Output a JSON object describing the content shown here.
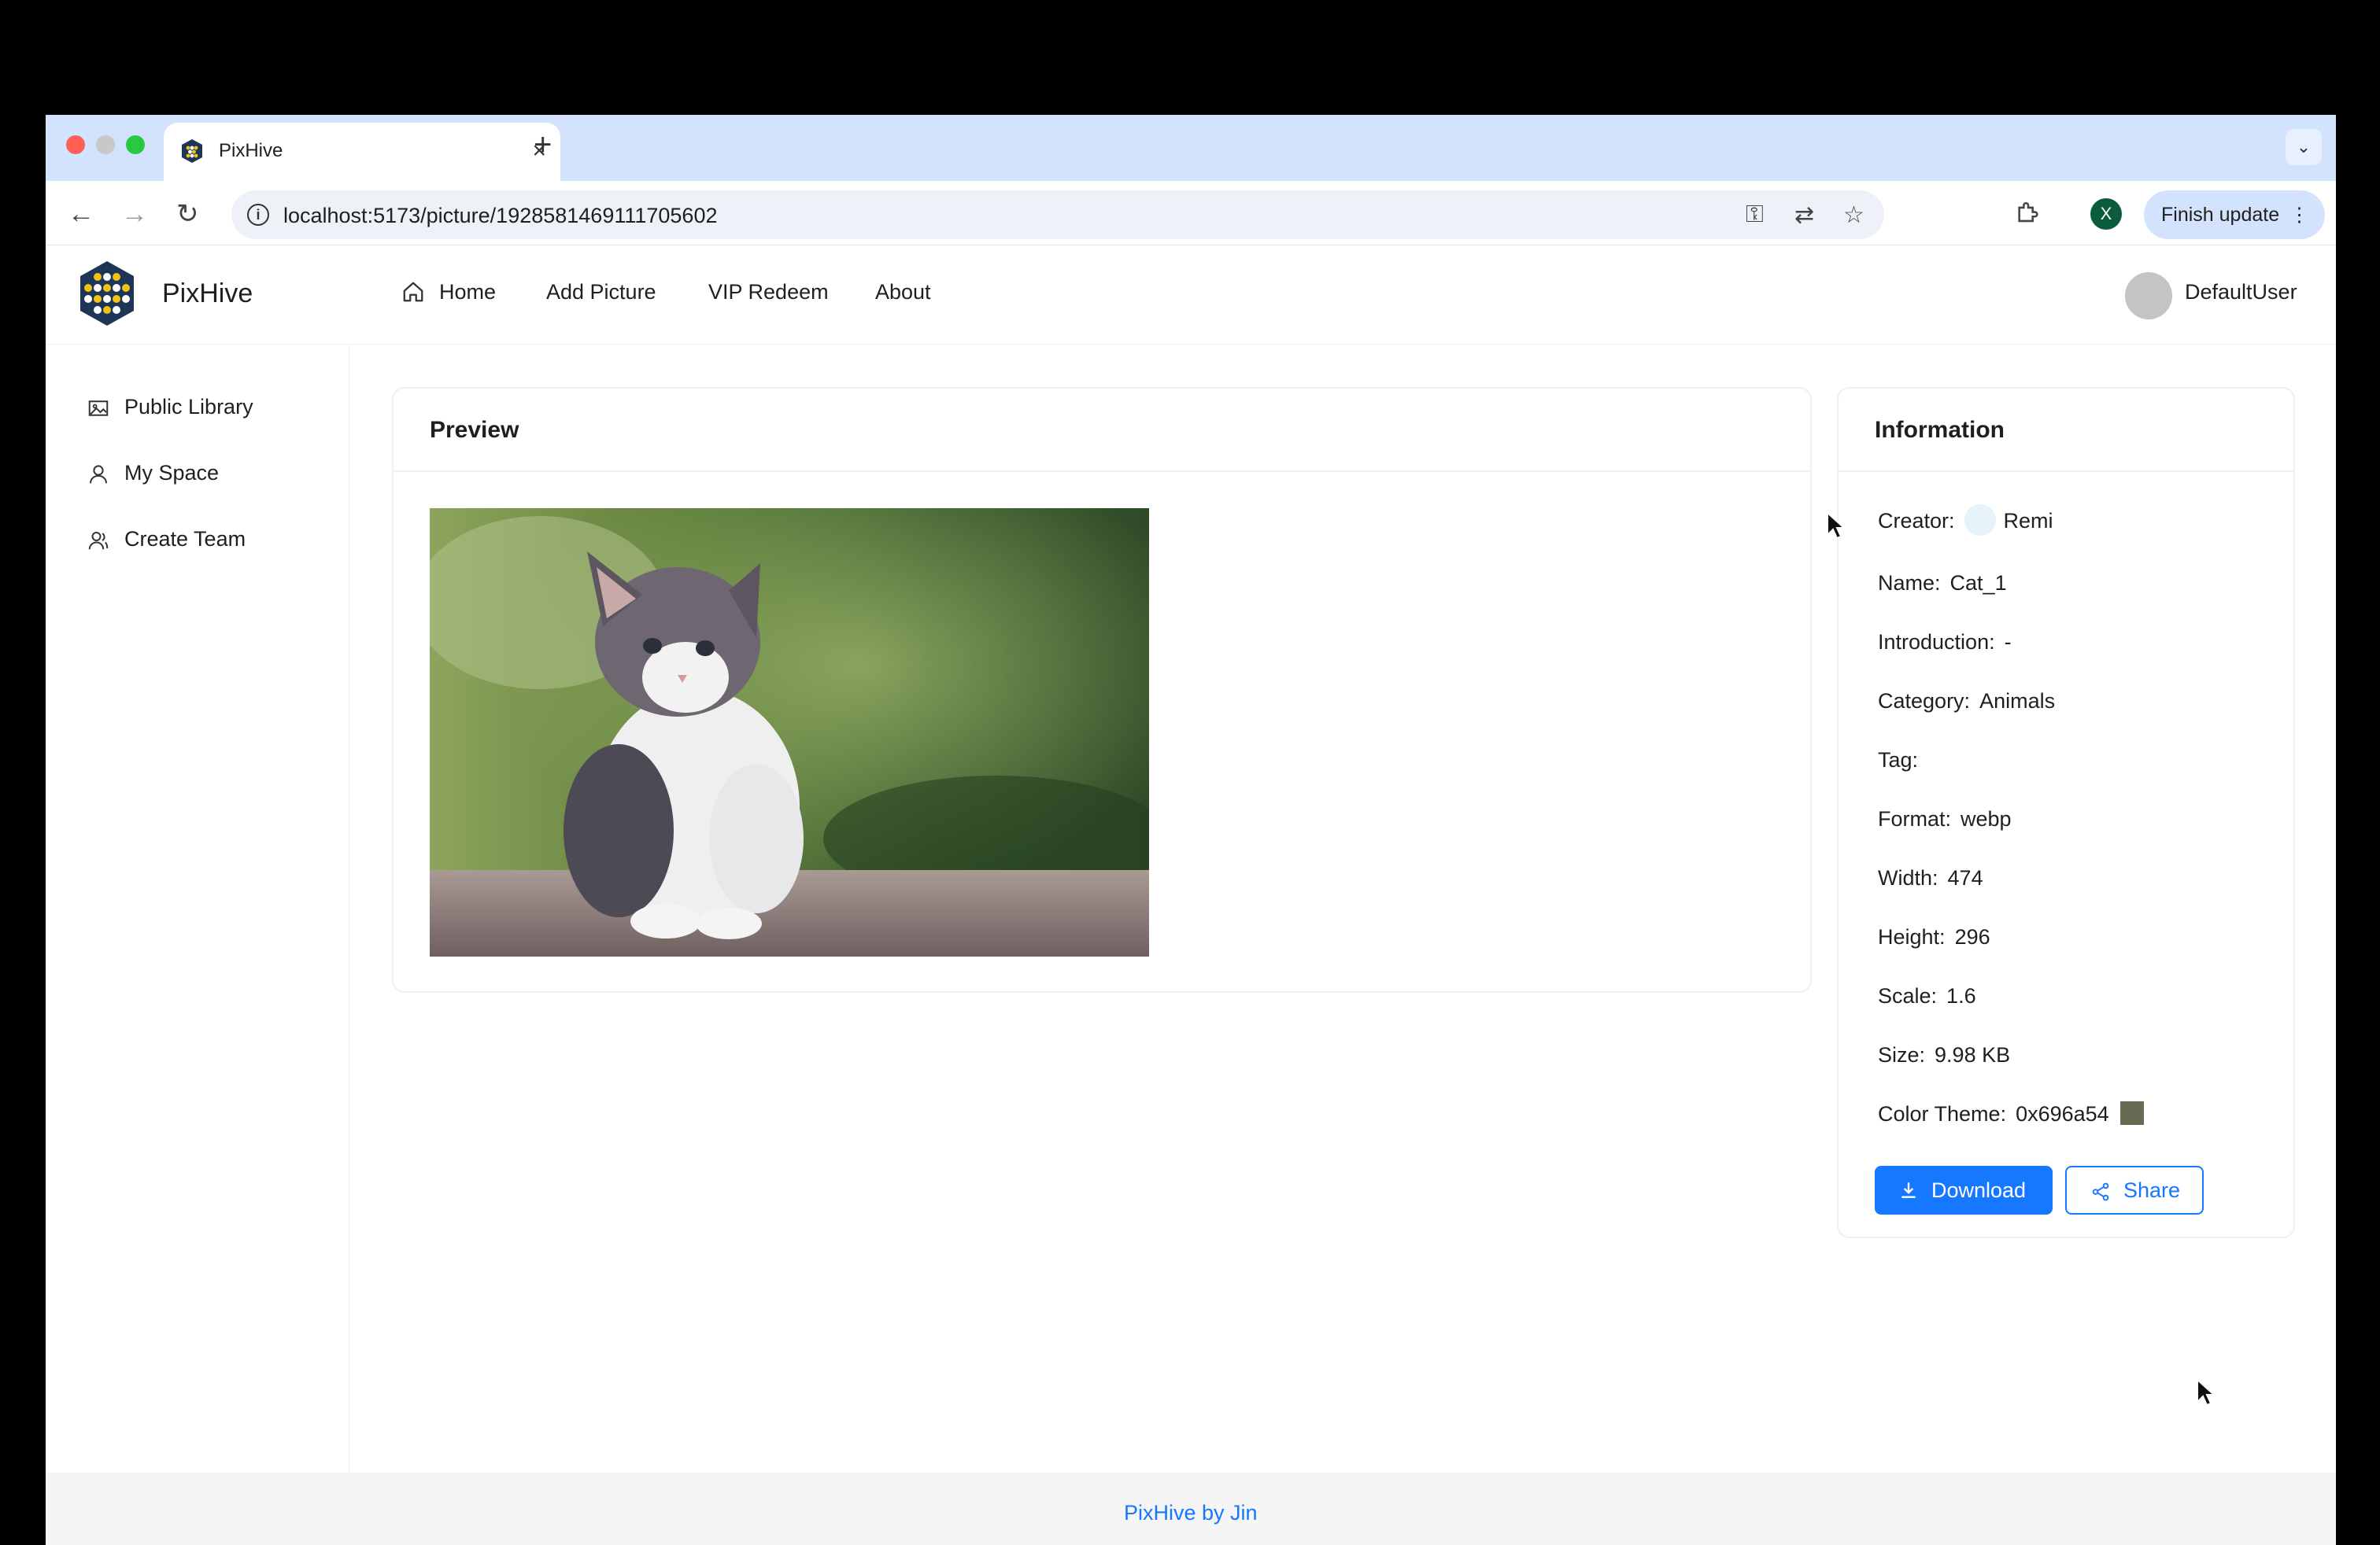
{
  "browser": {
    "tab_title": "PixHive",
    "url": "localhost:5173/picture/1928581469111705602",
    "profile_initial": "X",
    "finish_update_label": "Finish update"
  },
  "app": {
    "brand": "PixHive",
    "menu": [
      {
        "label": "Home"
      },
      {
        "label": "Add Picture"
      },
      {
        "label": "VIP Redeem"
      },
      {
        "label": "About"
      }
    ],
    "username": "DefaultUser"
  },
  "sidebar": {
    "items": [
      {
        "label": "Public Library"
      },
      {
        "label": "My Space"
      },
      {
        "label": "Create Team"
      }
    ]
  },
  "preview": {
    "title": "Preview"
  },
  "info": {
    "title": "Information",
    "rows": {
      "creator": {
        "label": "Creator:",
        "value": "Remi"
      },
      "name": {
        "label": "Name:",
        "value": "Cat_1"
      },
      "introduction": {
        "label": "Introduction:",
        "value": "-"
      },
      "category": {
        "label": "Category:",
        "value": "Animals"
      },
      "tag": {
        "label": "Tag:",
        "value": ""
      },
      "format": {
        "label": "Format:",
        "value": "webp"
      },
      "width": {
        "label": "Width:",
        "value": "474"
      },
      "height": {
        "label": "Height:",
        "value": "296"
      },
      "scale": {
        "label": "Scale:",
        "value": "1.6"
      },
      "size": {
        "label": "Size:",
        "value": "9.98 KB"
      },
      "color_theme": {
        "label": "Color Theme:",
        "value": "0x696a54",
        "swatch": "#696a54"
      }
    },
    "download_label": "Download",
    "share_label": "Share"
  },
  "footer": {
    "text": "PixHive by Jin"
  },
  "colors": {
    "primary": "#1677ff",
    "tabstrip": "#d3e3fd"
  }
}
